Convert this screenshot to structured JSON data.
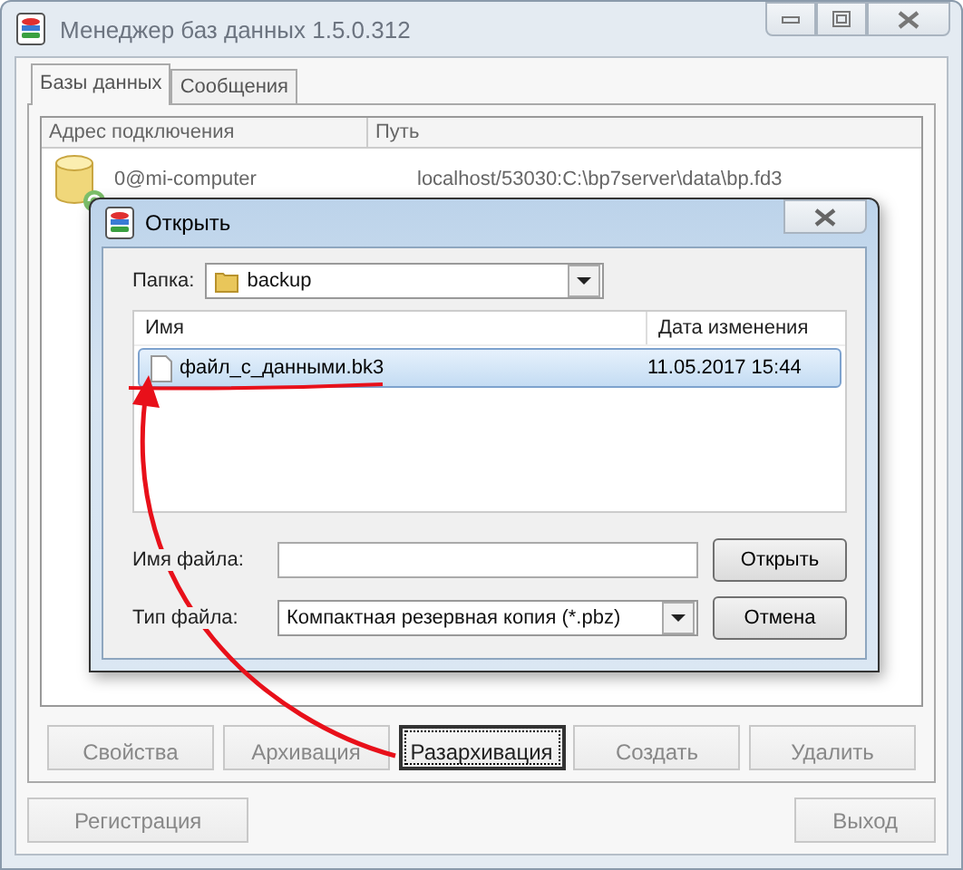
{
  "window": {
    "title": "Менеджер баз данных 1.5.0.312"
  },
  "tabs": [
    {
      "label": "Базы данных",
      "selected": true
    },
    {
      "label": "Сообщения",
      "selected": false
    }
  ],
  "table": {
    "columns": [
      "Адрес подключения",
      "Путь"
    ],
    "rows": [
      {
        "address": "0@mi-computer",
        "path": "localhost/53030:C:\\bp7server\\data\\bp.fd3"
      }
    ]
  },
  "buttons": [
    {
      "label": "Свойства",
      "disabled": true,
      "focused": false
    },
    {
      "label": "Архивация",
      "disabled": true,
      "focused": false
    },
    {
      "label": "Разархивация",
      "disabled": false,
      "focused": true
    },
    {
      "label": "Создать",
      "disabled": true,
      "focused": false
    },
    {
      "label": "Удалить",
      "disabled": true,
      "focused": false
    }
  ],
  "footer_buttons": [
    {
      "label": "Регистрация",
      "disabled": true
    },
    {
      "label": "Выход",
      "disabled": true
    }
  ],
  "dialog": {
    "title": "Открыть",
    "folder_label": "Папка:",
    "folder": "backup",
    "columns": [
      "Имя",
      "Дата изменения"
    ],
    "files": [
      {
        "name": "файл_с_данными.bk3",
        "date": "11.05.2017 15:44",
        "selected": true
      }
    ],
    "filename_label": "Имя файла:",
    "filetype_label": "Тип файла:",
    "filetype": "Компактная резервная копия (*.pbz)",
    "buttons": [
      {
        "label": "Открыть"
      },
      {
        "label": "Отмена"
      }
    ]
  }
}
